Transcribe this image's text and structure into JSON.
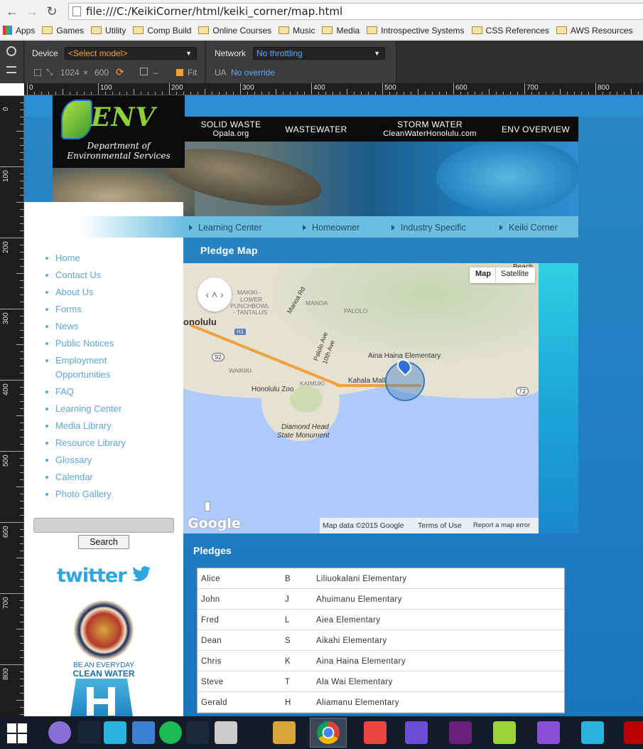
{
  "browser": {
    "url": "file:///C:/KeikiCorner/html/keiki_corner/map.html",
    "bookmarks": [
      {
        "label": "Apps",
        "icon": "apps-grid-icon"
      },
      {
        "label": "Games",
        "icon": "folder-icon"
      },
      {
        "label": "Utility",
        "icon": "folder-icon"
      },
      {
        "label": "Comp Build",
        "icon": "folder-icon"
      },
      {
        "label": "Online Courses",
        "icon": "folder-icon"
      },
      {
        "label": "Music",
        "icon": "folder-icon"
      },
      {
        "label": "Media",
        "icon": "folder-icon"
      },
      {
        "label": "Introspective Systems",
        "icon": "folder-icon"
      },
      {
        "label": "CSS References",
        "icon": "folder-icon"
      },
      {
        "label": "AWS Resources",
        "icon": "folder-icon"
      }
    ]
  },
  "devtools": {
    "device_label": "Device",
    "device_value": "<Select model>",
    "network_label": "Network",
    "network_value": "No throttling",
    "width": "1024",
    "times": "×",
    "height": "600",
    "dash": "–",
    "fit_label": "Fit",
    "ua_label": "UA",
    "ua_value": "No override",
    "ruler_h": [
      "0",
      "100",
      "200",
      "300",
      "400",
      "500",
      "600",
      "700",
      "800"
    ],
    "ruler_v": [
      "0",
      "100",
      "200",
      "300",
      "400",
      "500",
      "600",
      "700",
      "800"
    ]
  },
  "header": {
    "logo_text": "ENV",
    "dept_line1": "Department of",
    "dept_line2": "Environmental Services",
    "nav": [
      {
        "label": "SOLID WASTE",
        "sub": "Opala.org"
      },
      {
        "label": "WASTEWATER",
        "sub": ""
      },
      {
        "label": "STORM WATER",
        "sub": "CleanWaterHonolulu.com"
      },
      {
        "label": "ENV OVERVIEW",
        "sub": ""
      }
    ],
    "subnav": [
      "Learning Center",
      "Homeowner",
      "Industry Specific",
      "Keiki Corner"
    ]
  },
  "sidebar": {
    "links": [
      "Home",
      "Contact Us",
      "About Us",
      "Forms",
      "News",
      "Public Notices",
      "Employment",
      "Opportunities",
      "FAQ",
      "Learning Center",
      "Media Library",
      "Resource Library",
      "Glossary",
      "Calendar",
      "Photo Gallery"
    ],
    "search_button": "Search",
    "twitter": "twitter",
    "seal_caption1": "BE AN EVERYDAY",
    "seal_caption2": "CLEAN WATER"
  },
  "main": {
    "map_title": "Pledge Map",
    "map_type_map": "Map",
    "map_type_satellite": "Satellite",
    "map_labels": {
      "honolulu": "onolulu",
      "manoa": "MANOA",
      "makiki": "MAKIKI -",
      "lower": "LOWER",
      "punchbowl": "PUNCHBOWL",
      "tantalus": "- TANTALUS",
      "manoa_rd": "Manoa Rd",
      "palolo": "PALOLO",
      "palolo_ave": "Palolo Ave",
      "tenth_ave": "10th Ave",
      "waikiki": "WAIKIKI",
      "kaimuki": "KAIMUKI",
      "zoo": "Honolulu Zoo",
      "kahala": "Kahala Mall",
      "aina_haina": "Aina Haina Elementary",
      "diamond1": "Diamond Head",
      "diamond2": "State Monument",
      "beach": "Beach",
      "h1": "H1",
      "r92": "92",
      "r72": "72"
    },
    "map_footer": [
      "Map data ©2015 Google",
      "Terms of Use",
      "Report a map error"
    ],
    "google": "Google",
    "pledges_title": "Pledges",
    "pledges": [
      {
        "first": "Alice",
        "initial": "B",
        "school": "Liliuokalani Elementary"
      },
      {
        "first": "John",
        "initial": "J",
        "school": "Ahuimanu Elementary"
      },
      {
        "first": "Fred",
        "initial": "L",
        "school": "Aiea Elementary"
      },
      {
        "first": "Dean",
        "initial": "S",
        "school": "Aikahi Elementary"
      },
      {
        "first": "Chris",
        "initial": "K",
        "school": "Aina Haina Elementary"
      },
      {
        "first": "Steve",
        "initial": "T",
        "school": "Ala Wai Elementary"
      },
      {
        "first": "Gerald",
        "initial": "H",
        "school": "Aliamanu Elementary"
      }
    ]
  },
  "taskbar": {
    "apps": [
      "start-icon",
      "github-icon",
      "terminal-icon",
      "webstorm-icon",
      "thunderbird-icon",
      "spotify-icon",
      "steam-icon",
      "network-icon",
      "file-explorer-icon",
      "chrome-icon",
      "apps-tiles-icon",
      "infinity-icon",
      "visual-studio-icon",
      "notepad-plus-icon",
      "visual-studio-purple-icon",
      "webstorm-icon",
      "filezilla-icon"
    ]
  }
}
